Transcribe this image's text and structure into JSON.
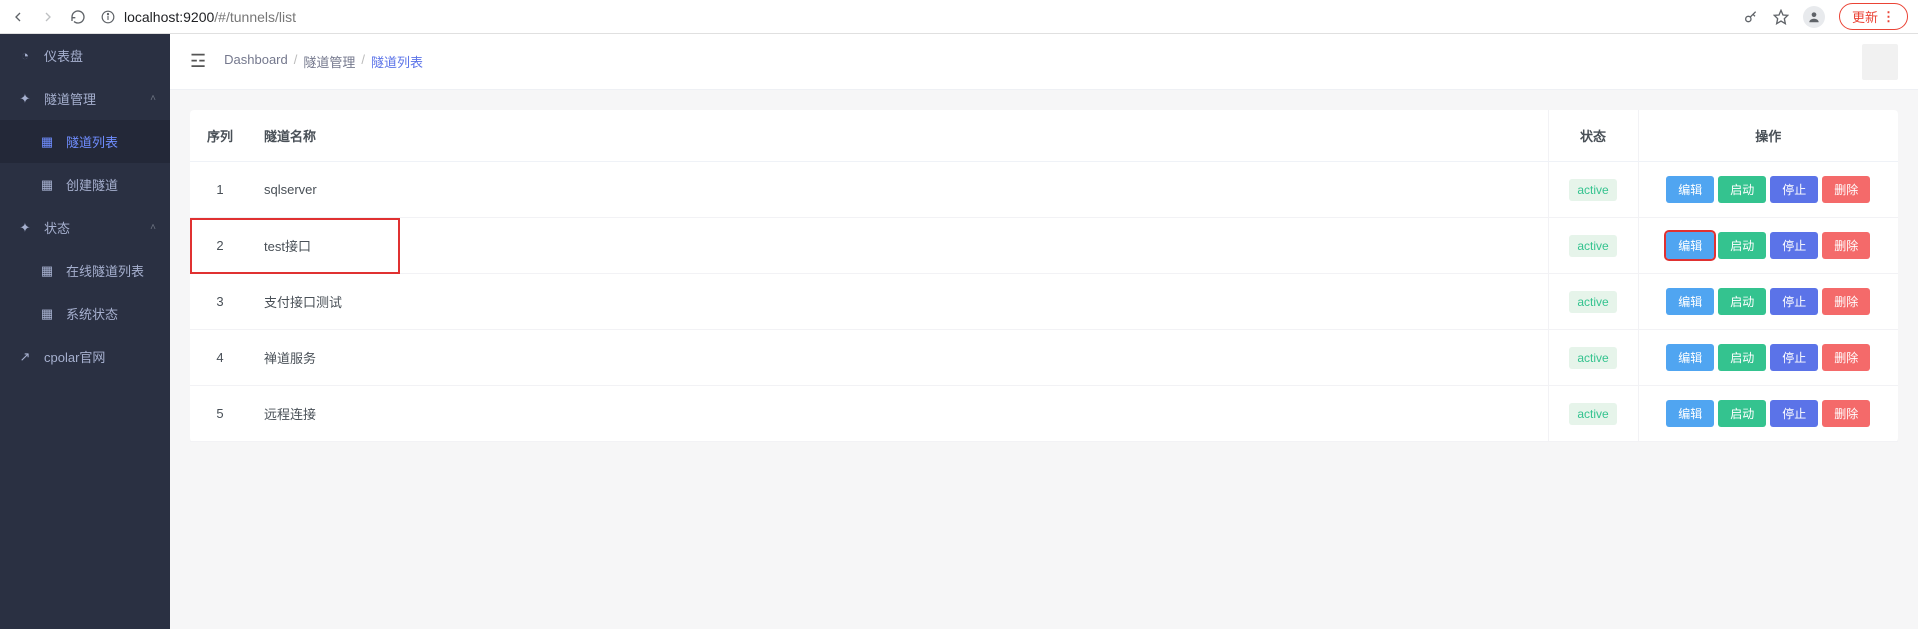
{
  "browser": {
    "url_host": "localhost:9200",
    "url_path": "/#/tunnels/list",
    "update_label": "更新"
  },
  "sidebar": {
    "items": [
      {
        "icon": "◔",
        "label": "仪表盘",
        "kind": "head"
      },
      {
        "icon": "✦",
        "label": "隧道管理",
        "kind": "head",
        "chev": "˄"
      },
      {
        "icon": "▦",
        "label": "隧道列表",
        "kind": "sub",
        "active": true
      },
      {
        "icon": "▦",
        "label": "创建隧道",
        "kind": "sub"
      },
      {
        "icon": "✦",
        "label": "状态",
        "kind": "head",
        "chev": "˄"
      },
      {
        "icon": "▦",
        "label": "在线隧道列表",
        "kind": "sub"
      },
      {
        "icon": "▦",
        "label": "系统状态",
        "kind": "sub"
      },
      {
        "icon": "↗",
        "label": "cpolar官网",
        "kind": "head"
      }
    ]
  },
  "breadcrumb": {
    "items": [
      "Dashboard",
      "隧道管理",
      "隧道列表"
    ]
  },
  "table": {
    "headers": {
      "idx": "序列",
      "name": "隧道名称",
      "status": "状态",
      "ops": "操作"
    },
    "ops_labels": {
      "edit": "编辑",
      "start": "启动",
      "stop": "停止",
      "del": "删除"
    },
    "rows": [
      {
        "idx": "1",
        "name": "sqlserver",
        "status": "active"
      },
      {
        "idx": "2",
        "name": "test接口",
        "status": "active",
        "highlight": true
      },
      {
        "idx": "3",
        "name": "支付接口测试",
        "status": "active"
      },
      {
        "idx": "4",
        "name": "禅道服务",
        "status": "active"
      },
      {
        "idx": "5",
        "name": "远程连接",
        "status": "active"
      }
    ]
  }
}
